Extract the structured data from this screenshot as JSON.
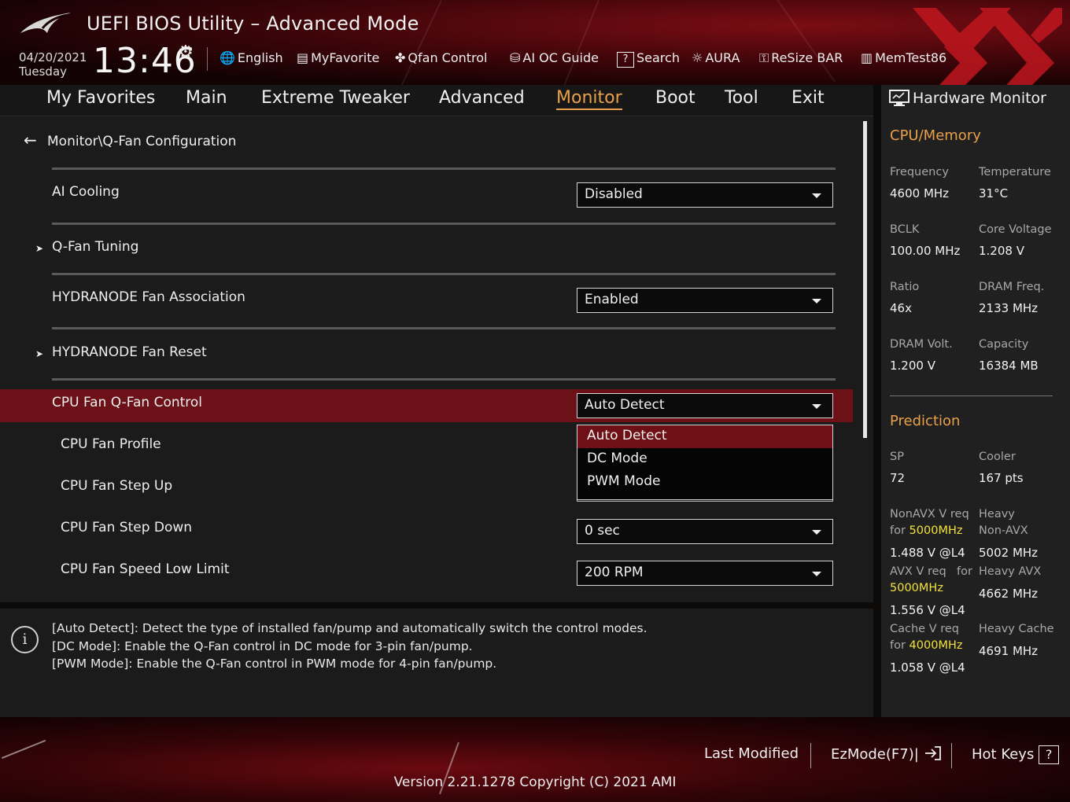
{
  "header": {
    "title": "UEFI BIOS Utility – Advanced Mode",
    "date": "04/20/2021",
    "day": "Tuesday",
    "time": "13:46",
    "tools": [
      {
        "label": "English",
        "icon": "globe-icon"
      },
      {
        "label": "MyFavorite",
        "icon": "favorite-icon"
      },
      {
        "label": "Qfan Control",
        "icon": "fan-icon"
      },
      {
        "label": "AI OC Guide",
        "icon": "ai-oc-icon"
      },
      {
        "label": "Search",
        "icon": "search-icon"
      },
      {
        "label": "AURA",
        "icon": "aura-icon"
      },
      {
        "label": "ReSize BAR",
        "icon": "resize-bar-icon"
      },
      {
        "label": "MemTest86",
        "icon": "memtest-icon"
      }
    ]
  },
  "tabs": [
    {
      "label": "My Favorites"
    },
    {
      "label": "Main"
    },
    {
      "label": "Extreme Tweaker"
    },
    {
      "label": "Advanced"
    },
    {
      "label": "Monitor",
      "active": true
    },
    {
      "label": "Boot"
    },
    {
      "label": "Tool"
    },
    {
      "label": "Exit"
    }
  ],
  "breadcrumb": "Monitor\\Q-Fan Configuration",
  "settings": {
    "ai_cooling": {
      "label": "AI Cooling",
      "value": "Disabled"
    },
    "qfan_tuning": {
      "label": "Q-Fan Tuning"
    },
    "hydranode_assoc": {
      "label": "HYDRANODE Fan Association",
      "value": "Enabled"
    },
    "hydranode_reset": {
      "label": "HYDRANODE Fan Reset"
    },
    "cpu_fan_control": {
      "label": "CPU Fan Q-Fan Control",
      "value": "Auto Detect"
    },
    "cpu_fan_profile": {
      "label": "CPU Fan Profile"
    },
    "cpu_fan_step_up": {
      "label": "CPU Fan Step Up"
    },
    "cpu_fan_step_down": {
      "label": "CPU Fan Step Down",
      "value": "0 sec"
    },
    "cpu_fan_low_limit": {
      "label": "CPU Fan Speed Low Limit",
      "value": "200 RPM"
    }
  },
  "dropdown_options": [
    "Auto Detect",
    "DC Mode",
    "PWM Mode"
  ],
  "info": [
    "[Auto Detect]: Detect the type of installed fan/pump and automatically switch the control modes.",
    "[DC Mode]: Enable the Q-Fan control in DC mode for 3-pin fan/pump.",
    "[PWM Mode]: Enable the Q-Fan control in PWM mode for 4-pin fan/pump."
  ],
  "hw_monitor": {
    "title": "Hardware Monitor",
    "cpu_memory": {
      "title": "CPU/Memory",
      "items": [
        {
          "label": "Frequency",
          "value": "4600 MHz"
        },
        {
          "label": "Temperature",
          "value": "31°C"
        },
        {
          "label": "BCLK",
          "value": "100.00 MHz"
        },
        {
          "label": "Core Voltage",
          "value": "1.208 V"
        },
        {
          "label": "Ratio",
          "value": "46x"
        },
        {
          "label": "DRAM Freq.",
          "value": "2133 MHz"
        },
        {
          "label": "DRAM Volt.",
          "value": "1.200 V"
        },
        {
          "label": "Capacity",
          "value": "16384 MB"
        }
      ]
    },
    "prediction": {
      "title": "Prediction",
      "sp_label": "SP",
      "sp_value": "72",
      "cooler_label": "Cooler",
      "cooler_value": "167 pts",
      "nonavx_label": "NonAVX V req",
      "nonavx_for": "for",
      "nonavx_freq": "5000MHz",
      "nonavx_value": "1.488 V @L4",
      "heavy_nonavx_label1": "Heavy",
      "heavy_nonavx_label2": "Non-AVX",
      "heavy_nonavx_value": "5002 MHz",
      "avx_label": "AVX V req",
      "avx_for": "for",
      "avx_freq": "5000MHz",
      "avx_value": "1.556 V @L4",
      "heavy_avx_label": "Heavy AVX",
      "heavy_avx_value": "4662 MHz",
      "cache_label": "Cache V req",
      "cache_for": "for",
      "cache_freq": "4000MHz",
      "cache_value": "1.058 V @L4",
      "heavy_cache_label": "Heavy Cache",
      "heavy_cache_value": "4691 MHz"
    }
  },
  "footer": {
    "last_modified": "Last Modified",
    "ezmode": "EzMode(F7)|",
    "hot_keys": "Hot Keys",
    "version": "Version 2.21.1278 Copyright (C) 2021 AMI"
  },
  "colors": {
    "accent": "#e8a14a",
    "highlight_row": "#6b1117",
    "hw_highlight": "#f2e23a"
  }
}
